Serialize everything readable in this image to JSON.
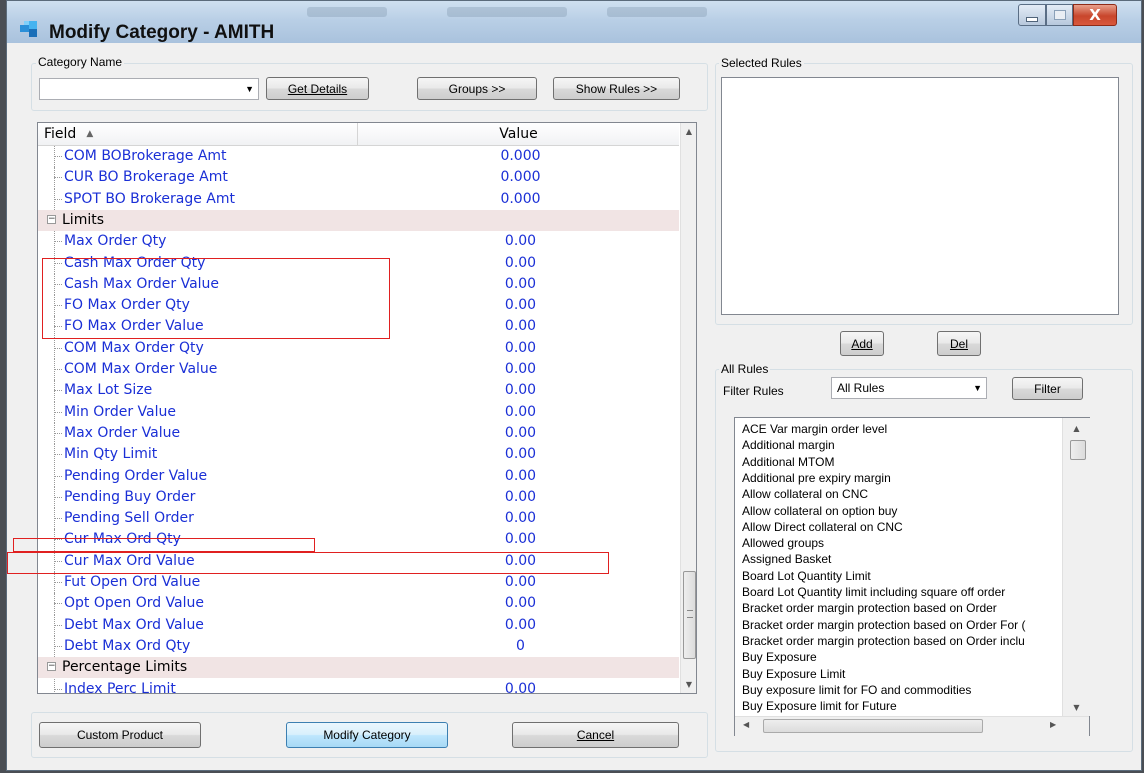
{
  "window": {
    "title": "Modify Category - AMITH",
    "controls": {
      "minimize": "–",
      "maximize": "□",
      "close": "X"
    }
  },
  "category": {
    "group_label": "Category Name",
    "selected_value": "",
    "get_details": "Get Details",
    "groups": "Groups >>",
    "show_rules": "Show Rules >>"
  },
  "grid": {
    "col_field": "Field",
    "col_value": "Value",
    "rows": [
      {
        "field": "COM BOBrokerage Amt",
        "value": "0.000"
      },
      {
        "field": "CUR BO Brokerage Amt",
        "value": "0.000"
      },
      {
        "field": "SPOT BO Brokerage Amt",
        "value": "0.000"
      },
      {
        "category": "Limits"
      },
      {
        "field": "Max Order Qty",
        "value": "0.00"
      },
      {
        "field": "Cash Max Order Qty",
        "value": "0.00"
      },
      {
        "field": "Cash Max Order Value",
        "value": "0.00"
      },
      {
        "field": "FO Max Order Qty",
        "value": "0.00"
      },
      {
        "field": "FO Max Order Value",
        "value": "0.00"
      },
      {
        "field": "COM Max Order Qty",
        "value": "0.00"
      },
      {
        "field": "COM Max Order Value",
        "value": "0.00"
      },
      {
        "field": "Max Lot Size",
        "value": "0.00"
      },
      {
        "field": "Min Order Value",
        "value": "0.00"
      },
      {
        "field": "Max Order Value",
        "value": "0.00"
      },
      {
        "field": "Min Qty Limit",
        "value": "0.00"
      },
      {
        "field": "Pending Order Value",
        "value": "0.00"
      },
      {
        "field": "Pending Buy Order",
        "value": "0.00"
      },
      {
        "field": "Pending Sell Order",
        "value": "0.00"
      },
      {
        "field": "Cur Max Ord Qty",
        "value": "0.00"
      },
      {
        "field": "Cur Max Ord Value",
        "value": "0.00"
      },
      {
        "field": "Fut Open Ord Value",
        "value": "0.00"
      },
      {
        "field": "Opt Open Ord Value",
        "value": "0.00"
      },
      {
        "field": "Debt Max Ord Value",
        "value": "0.00"
      },
      {
        "field": "Debt Max Ord Qty",
        "value": "0"
      },
      {
        "category": "Percentage Limits"
      },
      {
        "field": "Index Perc Limit",
        "value": "0.00"
      }
    ]
  },
  "selected_rules": {
    "label": "Selected Rules",
    "items": []
  },
  "rule_buttons": {
    "add": "Add",
    "del": "Del"
  },
  "all_rules": {
    "group_label": "All Rules",
    "filter_label": "Filter Rules",
    "filter_value": "All Rules",
    "filter_button": "Filter",
    "items": [
      "ACE Var margin order level",
      "Additional margin",
      "Additional MTOM",
      "Additional pre expiry margin",
      "Allow collateral on CNC",
      "Allow collateral on option buy",
      "Allow Direct collateral on CNC",
      "Allowed groups",
      "Assigned Basket",
      "Board Lot Quantity Limit",
      "Board Lot Quantity limit including square off order",
      "Bracket order margin protection based on Order",
      "Bracket order margin protection based on Order For (",
      "Bracket order margin protection based on Order inclu",
      "Buy Exposure",
      "Buy Exposure Limit",
      "Buy exposure limit for FO and commodities",
      "Buy Exposure limit for Future"
    ]
  },
  "footer": {
    "custom_product": "Custom Product",
    "modify_category": "Modify Category",
    "cancel": "Cancel"
  }
}
